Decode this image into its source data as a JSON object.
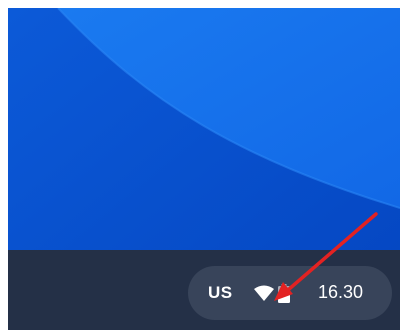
{
  "desktop": {
    "wallpaper_color": "#0a57d6"
  },
  "shelf": {
    "color": "#243047",
    "status_tray": {
      "ime_label": "US",
      "wifi_icon": "wifi-icon",
      "battery_icon": "battery-icon",
      "time": "16.30"
    }
  },
  "annotation": {
    "arrow_color": "#e32222"
  }
}
